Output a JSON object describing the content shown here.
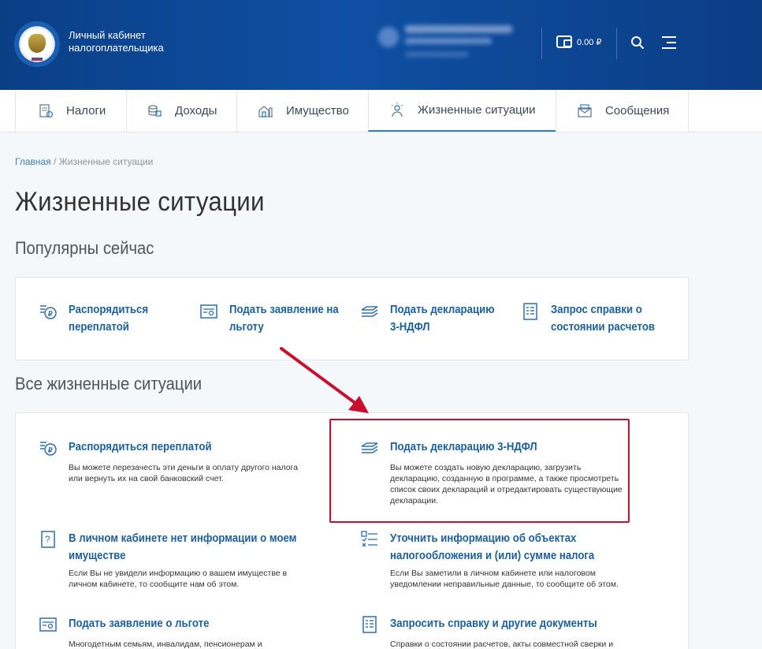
{
  "header": {
    "brand_line1": "Личный кабинет",
    "brand_line2": "налогоплательщика",
    "balance": "0.00 ₽"
  },
  "nav": {
    "tabs": [
      {
        "label": "Налоги",
        "icon": "taxes-icon"
      },
      {
        "label": "Доходы",
        "icon": "income-icon"
      },
      {
        "label": "Имущество",
        "icon": "property-icon"
      },
      {
        "label": "Жизненные ситуации",
        "icon": "life-situations-icon",
        "active": true
      },
      {
        "label": "Сообщения",
        "icon": "messages-icon"
      }
    ]
  },
  "breadcrumb": {
    "home": "Главная",
    "separator": " / ",
    "current": "Жизненные ситуации"
  },
  "page_title": "Жизненные ситуации",
  "popular": {
    "heading": "Популярны сейчас",
    "items": [
      {
        "label": "Распорядиться переплатой",
        "icon": "overpayment-icon"
      },
      {
        "label": "Подать заявление на льготу",
        "icon": "benefit-application-icon"
      },
      {
        "label": "Подать декларацию 3-НДФЛ",
        "icon": "declaration-icon"
      },
      {
        "label": "Запрос справки о состоянии расчетов",
        "icon": "certificate-request-icon"
      }
    ]
  },
  "all": {
    "heading": "Все жизненные ситуации",
    "items": [
      {
        "title": "Распорядиться переплатой",
        "desc": "Вы можете перезачесть эти деньги в оплату другого налога или вернуть их на свой банковский счет.",
        "icon": "overpayment-icon"
      },
      {
        "title": "Подать декларацию 3-НДФЛ",
        "desc": "Вы можете создать новую декларацию, загрузить декларацию, созданную в программе, а также просмотреть список своих деклараций и отредактировать существующие декларации.",
        "icon": "declaration-icon"
      },
      {
        "title": "В личном кабинете нет информации о моем имуществе",
        "desc": "Если Вы не увидели информацию о вашем имуществе в личном кабинете, то сообщите нам об этом.",
        "icon": "question-icon"
      },
      {
        "title": "Уточнить информацию об объектах налогообложения и (или) сумме налога",
        "desc": "Если Вы заметили в личном кабинете или налоговом уведомлении неправильные данные, то сообщите об этом.",
        "icon": "checklist-icon"
      },
      {
        "title": "Подать заявление о льготе",
        "desc": "Многодетным семьям, инвалидам, пенсионерам и",
        "icon": "benefit-application-icon"
      },
      {
        "title": "Запросить справку и другие документы",
        "desc": "Справки о состоянии расчетов, акты совместной сверки и",
        "icon": "certificate-request-icon"
      }
    ]
  },
  "colors": {
    "header_blue": "#0f4fa3",
    "link_blue": "#1c5f9d",
    "highlight_red": "#c8102e"
  }
}
